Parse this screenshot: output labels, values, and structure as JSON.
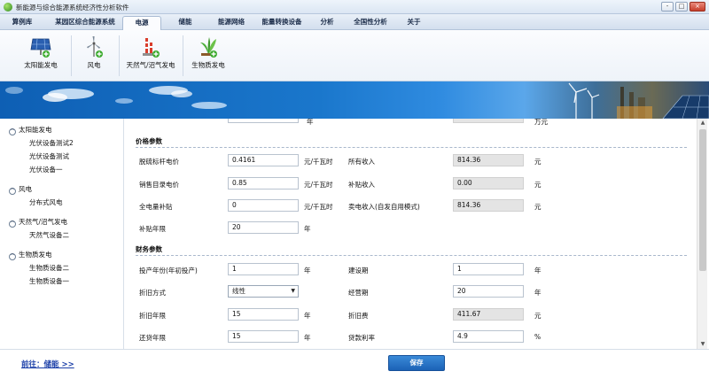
{
  "window": {
    "title": "新能源与综合能源系统经济性分析软件",
    "controls": [
      "-",
      "□",
      "×"
    ]
  },
  "menu": {
    "tabs": [
      "算例库",
      "某园区综合能源系统",
      "电源",
      "储能",
      "能源网络",
      "能量转换设备",
      "分析",
      "全国性分析",
      "关于"
    ],
    "active": "电源"
  },
  "ribbon": {
    "buttons": [
      {
        "label": "太阳能发电",
        "icon": "solar-panel-icon"
      },
      {
        "label": "风电",
        "icon": "wind-turbine-icon"
      },
      {
        "label": "天然气/沼气发电",
        "icon": "gas-plant-icon"
      },
      {
        "label": "生物质发电",
        "icon": "biomass-plant-icon"
      }
    ]
  },
  "sidebar": {
    "groups": [
      {
        "label": "太阳能发电",
        "toggle": "^",
        "items": [
          "光伏设备测试2",
          "光伏设备测试",
          "光伏设备一"
        ]
      },
      {
        "label": "风电",
        "toggle": "^",
        "items": [
          "分布式风电"
        ]
      },
      {
        "label": "天然气/沼气发电",
        "toggle": "^",
        "items": [
          "天然气设备二"
        ]
      },
      {
        "label": "生物质发电",
        "toggle": "^",
        "items": [
          "生物质设备二",
          "生物质设备一"
        ]
      }
    ]
  },
  "price": {
    "title": "价格参数",
    "coal_price": {
      "label": "脱硫标杆电价",
      "value": "0.4161",
      "unit": "元/千瓦时"
    },
    "sale_price": {
      "label": "销售目录电价",
      "value": "0.85",
      "unit": "元/千瓦时"
    },
    "subsidy": {
      "label": "全电量补贴",
      "value": "0",
      "unit": "元/千瓦时"
    },
    "subsidy_years": {
      "label": "补贴年限",
      "value": "20",
      "unit": "年"
    },
    "total_income": {
      "label": "所有收入",
      "value": "814.36",
      "unit": "元"
    },
    "subsidy_income": {
      "label": "补贴收入",
      "value": "0.00",
      "unit": "元"
    },
    "sale_income": {
      "label": "卖电收入(自发自用模式)",
      "value": "814.36",
      "unit": "元"
    }
  },
  "finance": {
    "title": "财务参数",
    "start_year": {
      "label": "投产年份(年初投产)",
      "value": "1",
      "unit": "年"
    },
    "depr_method": {
      "label": "折旧方式",
      "value": "线性"
    },
    "depr_years": {
      "label": "折旧年限",
      "value": "15",
      "unit": "年"
    },
    "loan_years": {
      "label": "还贷年限",
      "value": "15",
      "unit": "年"
    },
    "build_period": {
      "label": "建设期",
      "value": "1",
      "unit": "年"
    },
    "oper_period": {
      "label": "经营期",
      "value": "20",
      "unit": "年"
    },
    "depr_cost": {
      "label": "折旧费",
      "value": "411.67",
      "unit": "元"
    },
    "loan_rate": {
      "label": "贷款利率",
      "value": "4.9",
      "unit": "%"
    }
  },
  "top_partial": {
    "unit_left": "年",
    "unit_right": "万元"
  },
  "footer": {
    "prev": "前往：储能 >>",
    "save": "保存"
  }
}
